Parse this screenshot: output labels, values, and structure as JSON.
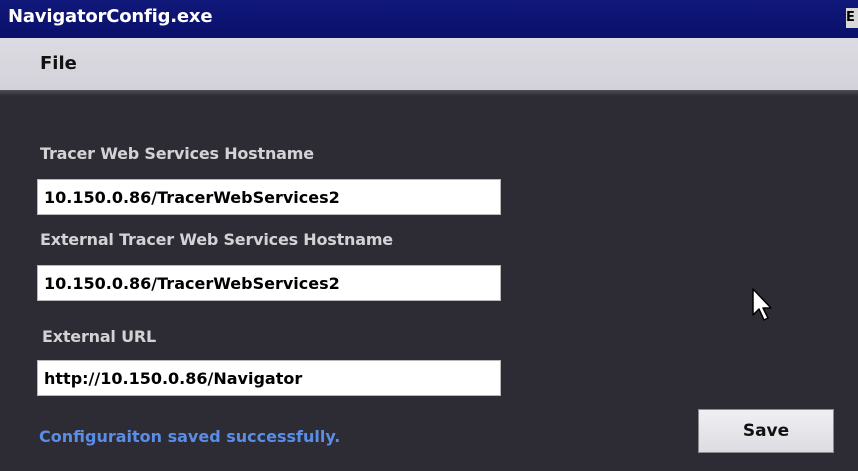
{
  "window": {
    "title": "NavigatorConfig.exe",
    "title_button_glyph": "E"
  },
  "menu": {
    "file_label": "File"
  },
  "form": {
    "tracer_hostname_label": "Tracer Web Services Hostname",
    "tracer_hostname_value": "10.150.0.86/TracerWebServices2",
    "external_hostname_label": "External Tracer Web Services Hostname",
    "external_hostname_value": "10.150.0.86/TracerWebServices2",
    "external_url_label": "External URL",
    "external_url_value": "http://10.150.0.86/Navigator"
  },
  "status": {
    "message": "Configuraiton saved successfully.",
    "color": "#5a8de6"
  },
  "buttons": {
    "save_label": "Save"
  },
  "icons": {
    "cursor": "mouse-pointer-icon"
  }
}
